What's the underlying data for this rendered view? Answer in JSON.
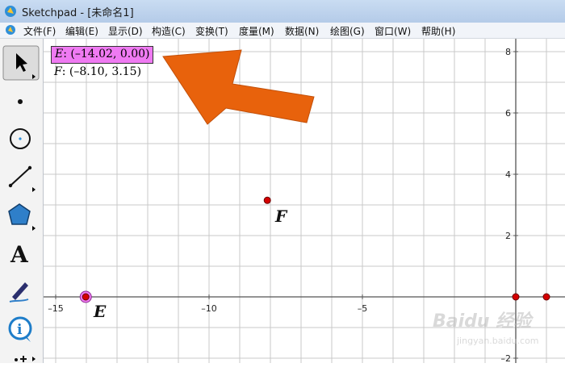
{
  "window": {
    "title": "Sketchpad  - [未命名1]"
  },
  "menu": [
    "文件(F)",
    "编辑(E)",
    "显示(D)",
    "构造(C)",
    "变换(T)",
    "度量(M)",
    "数据(N)",
    "绘图(G)",
    "窗口(W)",
    "帮助(H)"
  ],
  "tools": [
    "selection-arrow",
    "point",
    "compass",
    "straightedge",
    "polygon",
    "text",
    "marker",
    "information",
    "custom"
  ],
  "measurements": {
    "e": {
      "name": "E",
      "value": ": (–14.02, 0.00)"
    },
    "f": {
      "name": "F",
      "value": ": (–8.10, 3.15)"
    }
  },
  "points": {
    "e": {
      "label": "E",
      "x": -14.02,
      "y": 0.0,
      "selected": true
    },
    "f": {
      "label": "F",
      "x": -8.1,
      "y": 3.15,
      "selected": false
    },
    "origin": {
      "x": 0,
      "y": 0
    },
    "unit": {
      "x": 1,
      "y": 0
    }
  },
  "axes": {
    "x_ticks": [
      "–15",
      "–10",
      "–5"
    ],
    "y_ticks": [
      "8",
      "6",
      "4",
      "2",
      "–2"
    ]
  },
  "watermark": {
    "brand": "Baidu 经验",
    "url": "jingyan.baidu.com"
  },
  "colors": {
    "arrow": "#e8620c",
    "point": "#d50000",
    "selection": "#ef7af2",
    "grid": "#c9c9c9"
  }
}
